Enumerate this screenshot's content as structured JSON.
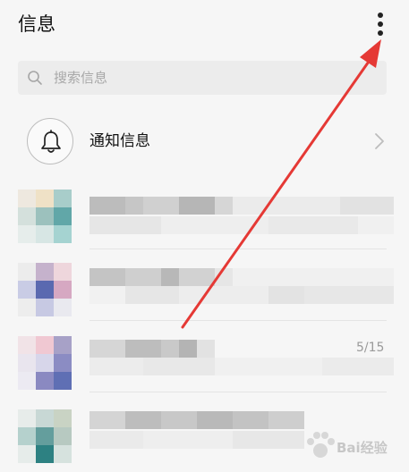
{
  "header": {
    "title": "信息",
    "more_icon": "vertical-ellipsis-icon"
  },
  "search": {
    "placeholder": "搜索信息",
    "icon": "search-icon"
  },
  "notification_entry": {
    "label": "通知信息",
    "icon": "bell-icon",
    "chevron": "chevron-right-icon"
  },
  "conversations": [
    {
      "preview": ""
    },
    {
      "preview": ""
    },
    {
      "preview": "",
      "count": "5/15"
    },
    {
      "preview": ""
    }
  ],
  "watermark": {
    "text": "Bai经验"
  },
  "annotation": {
    "arrow_color": "#e53935"
  }
}
